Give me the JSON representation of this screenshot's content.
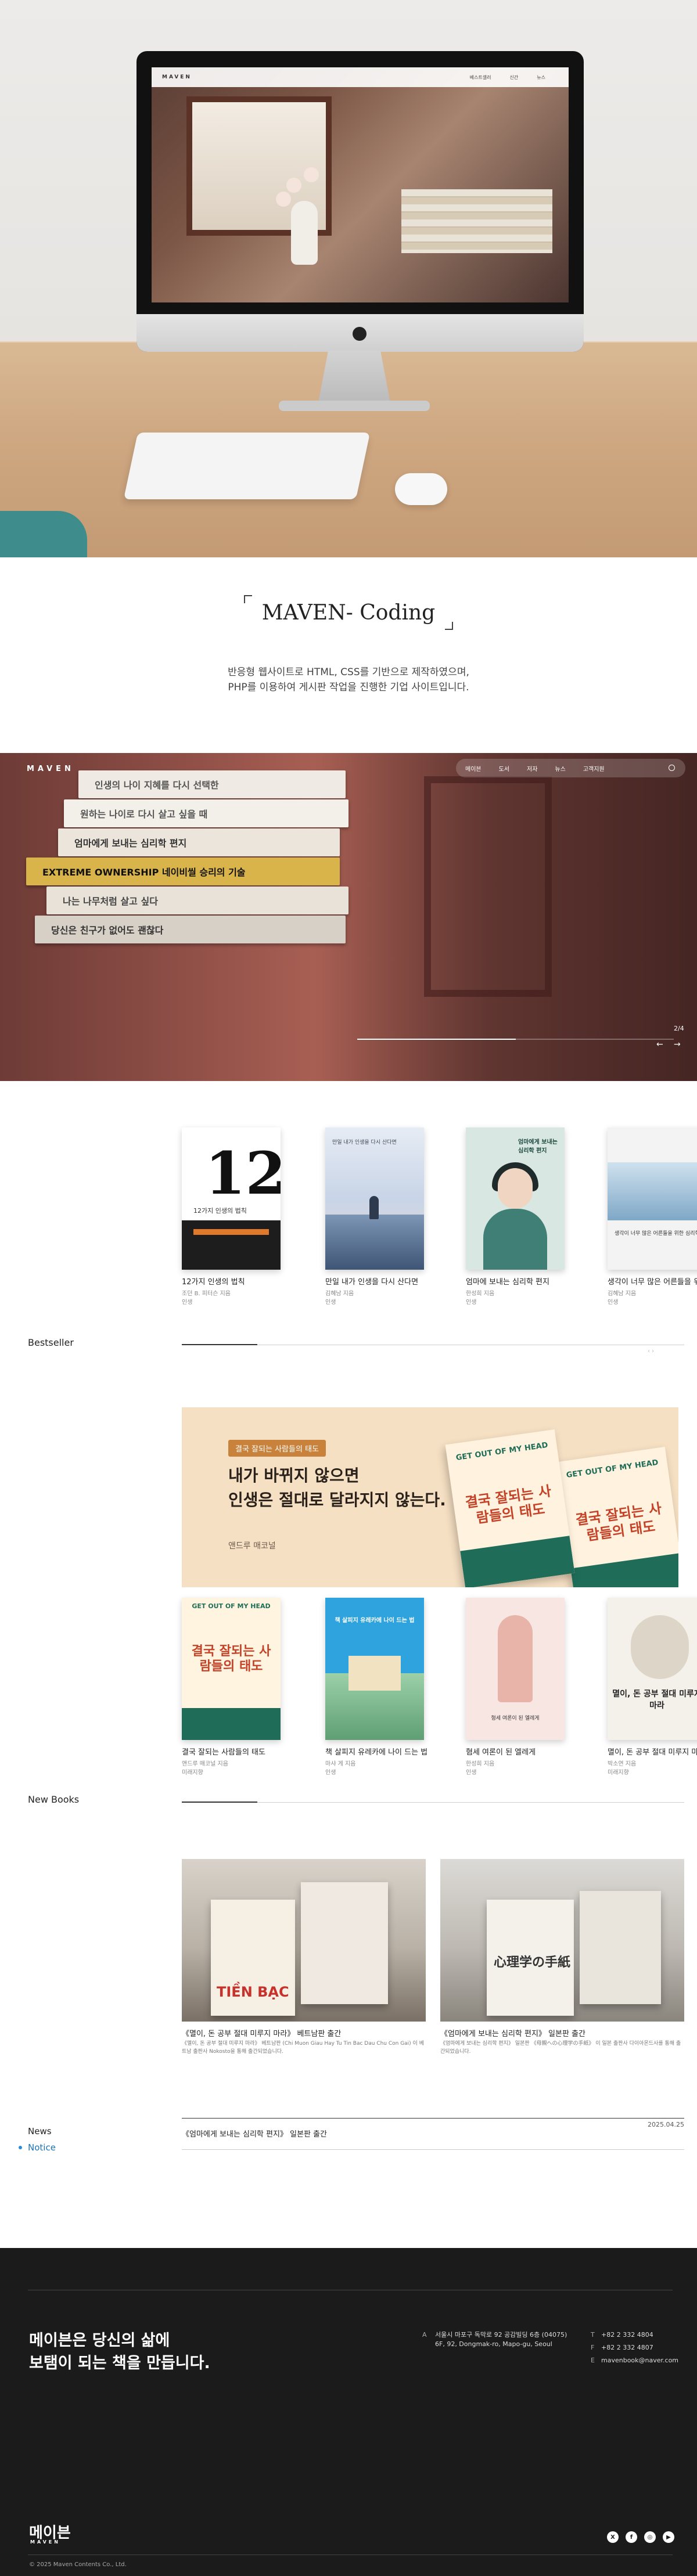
{
  "hero": {
    "mock_logo": "MAVEN",
    "mock_nav": [
      "베스트셀러",
      "신간",
      "뉴스"
    ]
  },
  "intro": {
    "title": "MAVEN- Coding",
    "desc_line1": "반응형 웹사이트로 HTML, CSS를 기반으로 제작하였으며,",
    "desc_line2": "PHP를 이용하여 게시판 작업을 진행한 기업 사이트입니다."
  },
  "banner": {
    "logo": "MAVEN",
    "nav": [
      "메이븐",
      "도서",
      "저자",
      "뉴스",
      "고객지원"
    ],
    "books": [
      "인생의 나이 지혜를 다시 선택한",
      "원하는 나이로 다시 살고 싶을 때",
      "엄마에게 보내는 심리학 편지",
      "EXTREME OWNERSHIP 네이비씰 승리의 기술",
      "나는 나무처럼 살고 싶다",
      "당신은 친구가 없어도 괜찮다"
    ],
    "counter": "2/4",
    "progress": 0.5,
    "prev": "←",
    "next": "→"
  },
  "bestseller": {
    "label": "Bestseller",
    "books": [
      {
        "title": "12가지 인생의 법칙",
        "author": "조던 B. 피터슨 지음",
        "publisher": "인생",
        "cover_text": "12",
        "cover_sub": "12가지 인생의 법칙"
      },
      {
        "title": "만일 내가 인생을 다시 산다면",
        "author": "김혜남 지음",
        "publisher": "인생",
        "cover_text": "만일 내가 인생을 다시 산다면"
      },
      {
        "title": "엄마에 보내는 심리학 편지",
        "author": "한성희 지음",
        "publisher": "인생",
        "cover_text": "엄마에게 보내는 심리학 편지"
      },
      {
        "title": "생각이 너무 많은 어른들을 위한 심리학",
        "author": "김혜남 지음",
        "publisher": "인생",
        "cover_text": "생각이 너무 많은 어른들을 위한 심리학"
      }
    ],
    "arrows": "‹ ›"
  },
  "new_books": {
    "label": "New Books",
    "promo": {
      "tag": "결국 잘되는 사람들의 태도",
      "line1": "내가 바뀌지 않으면",
      "line2": "인생은 절대로 달라지지 않는다.",
      "author": "앤드루 매코널",
      "book_header": "GET OUT OF MY HEAD",
      "book_title": "결국 잘되는 사람들의 태도"
    },
    "books": [
      {
        "title": "결국 잘되는 사람들의 태도",
        "author": "앤드루 매코널 지음",
        "publisher": "미래지향",
        "cover_header": "GET OUT OF MY HEAD",
        "cover_text": "결국 잘되는 사람들의 태도"
      },
      {
        "title": "책 살피지 유레카에 나이 드는 법",
        "author": "마샤 게 지음",
        "publisher": "인생",
        "cover_text": "책 살피지 유레카에 나이 드는 법"
      },
      {
        "title": "혐세 여론이 된 엘레게",
        "author": "한성희 지음",
        "publisher": "인생",
        "cover_text": "형세 여론이 된 엘레게"
      },
      {
        "title": "멸이, 돈 공부 절대 미루지 마라",
        "author": "박소연 지음",
        "publisher": "미래지향",
        "cover_text": "멸이, 돈 공부 절대 미루지 마라"
      }
    ]
  },
  "news": {
    "label": "News",
    "cards": [
      {
        "title": "《멸이, 돈 공부 절대 미루지 마라》 베트남판 출간",
        "desc": "《멸이, 돈 공부 절대 미루지 마라》 베트남판 (Chi Muon Giau Hay Tu Tin Bac Dau Chu Con Gai) 이 베트남 출판사 Nokosto을 통해 출간되었습니다.",
        "cover_label": "TIỀN BẠC"
      },
      {
        "title": "《엄마에게 보내는 심리학 편지》 일본판 출간",
        "desc": "《엄마에게 보내는 심리학 편지》 일본판 《母親への心理学の手紙》 이 일본 출판사 다이아몬드사를 통해 출간되었습니다.",
        "cover_label": "心理学の手紙"
      }
    ]
  },
  "notice": {
    "label": "Notice",
    "row_title": "《엄마에게 보내는 심리학 편지》 일본판 출간",
    "row_date": "2025.04.25"
  },
  "footer": {
    "slogan_line1": "메이븐은 당신의 삶에",
    "slogan_line2": "보탬이 되는 책을 만듭니다.",
    "address_key": "A",
    "address_ko": "서울시 마포구 독막로 92 공감빌딩 6층 (04075)",
    "address_en": "6F, 92, Dongmak-ro, Mapo-gu, Seoul",
    "phone_key": "T",
    "phone": "+82 2 332 4804",
    "fax_key": "F",
    "fax": "+82 2 332 4807",
    "email_key": "E",
    "email": "mavenbook@naver.com",
    "brand": "메이븐",
    "brand_sub": "MAVEN",
    "copyright": "© 2025 Maven Contents Co., Ltd.",
    "socials": [
      "x-icon",
      "facebook-icon",
      "instagram-icon",
      "youtube-icon"
    ]
  }
}
